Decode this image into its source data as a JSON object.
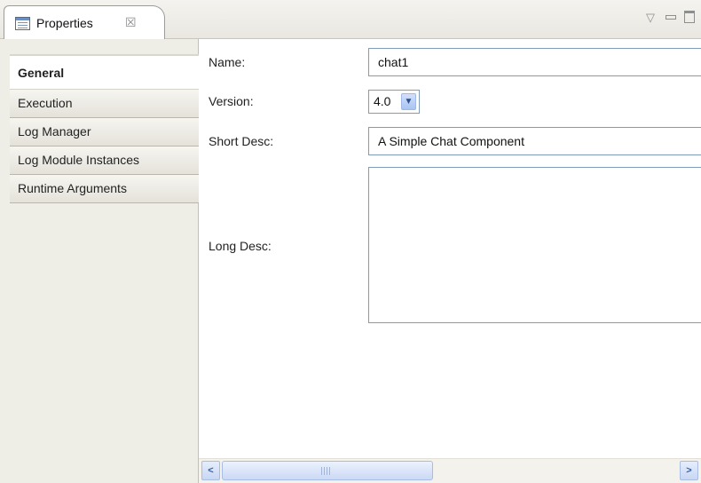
{
  "view_tab": {
    "title": "Properties",
    "close_symbol": "☒"
  },
  "view_controls": {
    "menu_symbol": "▽"
  },
  "nav": {
    "items": [
      {
        "label": "General",
        "selected": true
      },
      {
        "label": "Execution",
        "selected": false
      },
      {
        "label": "Log Manager",
        "selected": false
      },
      {
        "label": "Log Module Instances",
        "selected": false
      },
      {
        "label": "Runtime Arguments",
        "selected": false
      }
    ]
  },
  "form": {
    "name_label": "Name:",
    "name_value": "chat1",
    "version_label": "Version:",
    "version_value": "4.0",
    "short_desc_label": "Short Desc:",
    "short_desc_value": "A Simple Chat Component",
    "long_desc_label": "Long Desc:",
    "long_desc_value": ""
  },
  "scrollbar": {
    "left_symbol": "<",
    "right_symbol": ">",
    "position": 0.0
  },
  "icons": {
    "tab": "properties-view-icon",
    "close": "close-icon",
    "menu": "view-menu-icon",
    "minimize": "minimize-icon",
    "maximize": "maximize-icon",
    "select": "chevron-down-icon"
  },
  "colors": {
    "field_border": "#7f9db9",
    "nav_background": "#eeede6",
    "select_arrow": "#2e4f8e"
  }
}
